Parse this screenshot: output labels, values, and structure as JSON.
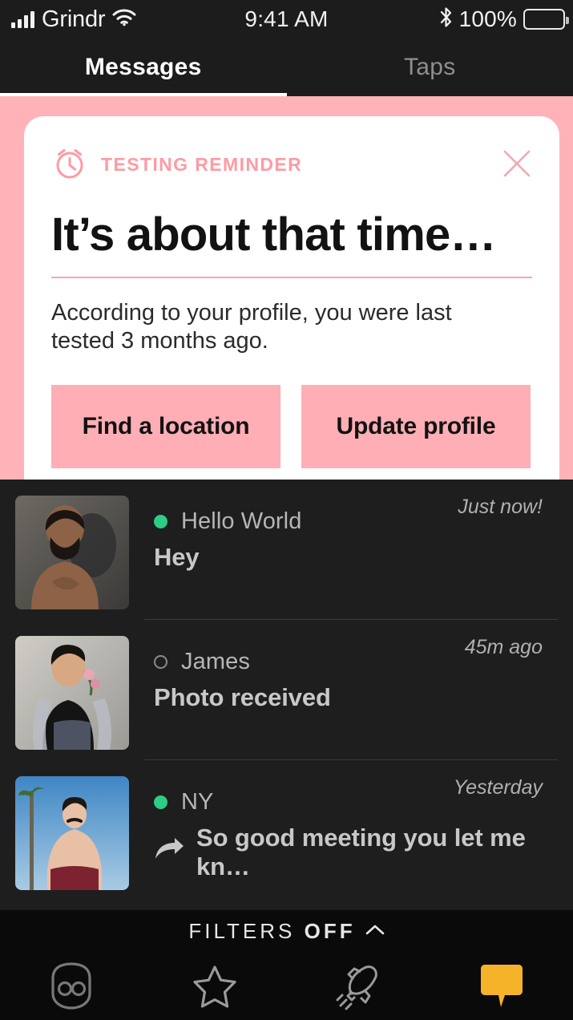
{
  "statusbar": {
    "carrier": "Grindr",
    "signal_icon": "cellular-bars-icon",
    "wifi_icon": "wifi-icon",
    "time": "9:41 AM",
    "bluetooth_icon": "bluetooth-icon",
    "battery_percent": "100%",
    "battery_icon": "battery-full-icon"
  },
  "tabs": [
    {
      "label": "Messages",
      "active": true
    },
    {
      "label": "Taps",
      "active": false
    }
  ],
  "promo": {
    "kicker": "TESTING REMINDER",
    "kicker_icon": "alarm-clock-icon",
    "close_icon": "close-icon",
    "title": "It’s about that time…",
    "body": "According to your profile, you were last tested 3 months ago.",
    "buttons": [
      {
        "label": "Find a location"
      },
      {
        "label": "Update profile"
      }
    ],
    "colors": {
      "background": "#ffb3b9",
      "card": "#ffffff",
      "accent": "#ff9aa4",
      "button": "#ffaeb5"
    }
  },
  "conversations": [
    {
      "name": "Hello World",
      "status": "online",
      "time": "Just now!",
      "preview": "Hey",
      "forwarded": false,
      "avatar_name": "avatar-hello-world"
    },
    {
      "name": "James",
      "status": "offline",
      "time": "45m ago",
      "preview": "Photo received",
      "forwarded": false,
      "avatar_name": "avatar-james"
    },
    {
      "name": "NY",
      "status": "online",
      "time": "Yesterday",
      "preview": "So good meeting you let me kn…",
      "forwarded": true,
      "forward_icon": "forward-arrow-icon",
      "avatar_name": "avatar-ny"
    }
  ],
  "filters": {
    "label_prefix": "FILTERS ",
    "label_value": "OFF",
    "chevron_icon": "chevron-up-icon"
  },
  "bottomnav": [
    {
      "icon": "grindr-mask-icon",
      "active": false
    },
    {
      "icon": "star-icon",
      "active": false
    },
    {
      "icon": "rocket-icon",
      "active": false
    },
    {
      "icon": "chat-bubble-icon",
      "active": true
    }
  ],
  "colors": {
    "online_dot": "#2ecc84",
    "active_tab_accent": "#ffc42e",
    "surface": "#1e1e1e",
    "statusbar": "#1c1c1c"
  }
}
